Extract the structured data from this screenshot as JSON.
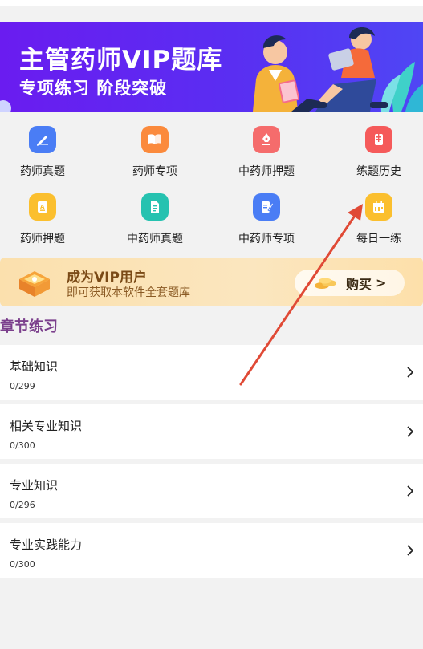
{
  "banner": {
    "title": "主管药师VIP题库",
    "subtitle": "专项练习 阶段突破"
  },
  "grid": {
    "items": [
      {
        "label": "药师真题",
        "icon": "pencil-note-icon",
        "color": "#4a7df5"
      },
      {
        "label": "药师专项",
        "icon": "open-book-icon",
        "color": "#fb8a3c"
      },
      {
        "label": "中药师押题",
        "icon": "fountain-pen-icon",
        "color": "#f56c6c"
      },
      {
        "label": "练题历史",
        "icon": "history-card-icon",
        "color": "#f55a5a"
      },
      {
        "label": "药师押题",
        "icon": "grade-paper-icon",
        "color": "#fbbf2e"
      },
      {
        "label": "中药师真题",
        "icon": "document-icon",
        "color": "#26c2b0"
      },
      {
        "label": "中药师专项",
        "icon": "edit-document-icon",
        "color": "#4a7df5"
      },
      {
        "label": "每日一练",
        "icon": "calendar-icon",
        "color": "#fbbf2e"
      }
    ]
  },
  "vip": {
    "title": "成为VIP用户",
    "description": "即可获取本软件全套题库",
    "button_label": "购买",
    "button_arrow": ">"
  },
  "section": {
    "title": "章节练习"
  },
  "chapters": [
    {
      "name": "基础知识",
      "progress": "0/299"
    },
    {
      "name": "相关专业知识",
      "progress": "0/300"
    },
    {
      "name": "专业知识",
      "progress": "0/296"
    },
    {
      "name": "专业实践能力",
      "progress": "0/300"
    }
  ],
  "colors": {
    "banner": "#5a2ef2",
    "section_title": "#7b3f8c",
    "annotation_arrow": "#e04a36"
  }
}
